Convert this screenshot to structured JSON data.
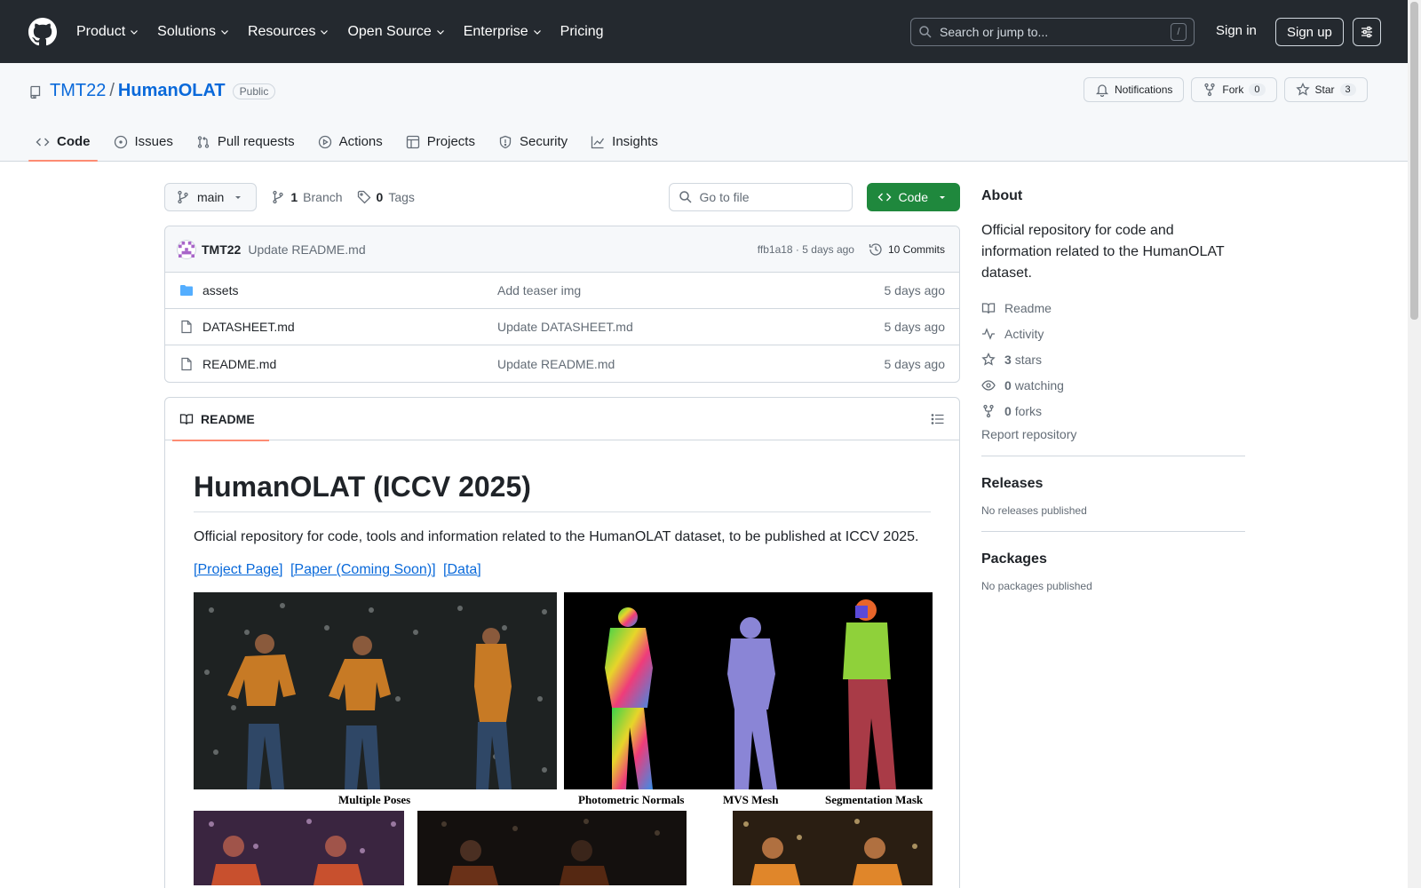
{
  "header": {
    "nav": [
      "Product",
      "Solutions",
      "Resources",
      "Open Source",
      "Enterprise",
      "Pricing"
    ],
    "search_placeholder": "Search or jump to...",
    "search_key": "/",
    "sign_in": "Sign in",
    "sign_up": "Sign up"
  },
  "repo": {
    "owner": "TMT22",
    "separator": "/",
    "name": "HumanOLAT",
    "visibility": "Public",
    "notifications": "Notifications",
    "fork_label": "Fork",
    "fork_count": "0",
    "star_label": "Star",
    "star_count": "3"
  },
  "tabs": [
    "Code",
    "Issues",
    "Pull requests",
    "Actions",
    "Projects",
    "Security",
    "Insights"
  ],
  "toolbar": {
    "branch": "main",
    "branch_count": "1",
    "branch_label": "Branch",
    "tag_count": "0",
    "tag_label": "Tags",
    "goto_placeholder": "Go to file",
    "code_button": "Code"
  },
  "latest_commit": {
    "author": "TMT22",
    "message": "Update README.md",
    "meta": "ffb1a18 · 5 days ago",
    "commits": "10 Commits"
  },
  "files": [
    {
      "name": "assets",
      "type": "folder",
      "commit": "Add teaser img",
      "date": "5 days ago"
    },
    {
      "name": "DATASHEET.md",
      "type": "file",
      "commit": "Update DATASHEET.md",
      "date": "5 days ago"
    },
    {
      "name": "README.md",
      "type": "file",
      "commit": "Update README.md",
      "date": "5 days ago"
    }
  ],
  "readme": {
    "tab": "README",
    "title": "HumanOLAT (ICCV 2025)",
    "description": "Official repository for code, tools and information related to the HumanOLAT dataset, to be published at ICCV 2025.",
    "links": [
      "[Project Page]",
      "[Paper (Coming Soon)]",
      "[Data]"
    ],
    "figure_captions": [
      "Multiple Poses",
      "Photometric Normals",
      "MVS Mesh",
      "Segmentation Mask"
    ]
  },
  "sidebar": {
    "about_title": "About",
    "about_desc": "Official repository for code and information related to the HumanOLAT dataset.",
    "readme": "Readme",
    "activity": "Activity",
    "stars_count": "3",
    "stars_label": "stars",
    "watching_count": "0",
    "watching_label": "watching",
    "forks_count": "0",
    "forks_label": "forks",
    "report": "Report repository",
    "releases_title": "Releases",
    "releases_none": "No releases published",
    "packages_title": "Packages",
    "packages_none": "No packages published"
  },
  "colors": {
    "header_bg": "#24292f",
    "accent_link": "#0969da",
    "code_button": "#1f883d",
    "tab_underline": "#fd8c73"
  }
}
